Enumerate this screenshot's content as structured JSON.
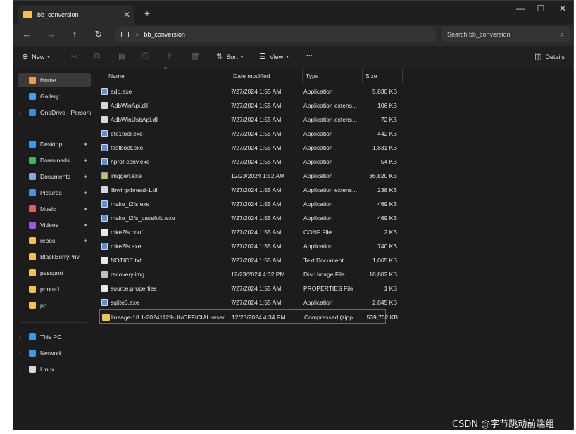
{
  "window": {
    "tab_title": "bb_conversion",
    "tab_close": "✕",
    "new_tab": "+",
    "minimize": "—",
    "maximize": "☐",
    "close": "✕"
  },
  "nav": {
    "back": "←",
    "forward": "→",
    "up": "↑",
    "refresh": "↻",
    "path": "bb_conversion",
    "search_placeholder": "Search bb_conversion"
  },
  "toolbar": {
    "new": "New",
    "sort": "Sort",
    "view": "View",
    "more": "···",
    "details": "Details"
  },
  "sidebar": {
    "items": [
      {
        "label": "Home",
        "icon": "home-icon",
        "color": "#e8a04a"
      },
      {
        "label": "Gallery",
        "icon": "gallery-icon",
        "color": "#4aa0e8"
      },
      {
        "label": "OneDrive - Persona",
        "icon": "cloud-icon",
        "color": "#3a8fd8"
      },
      {
        "label": "Desktop",
        "icon": "desktop-icon",
        "color": "#3a9ae8"
      },
      {
        "label": "Downloads",
        "icon": "download-icon",
        "color": "#3ab86a"
      },
      {
        "label": "Documents",
        "icon": "documents-icon",
        "color": "#8aa8d8"
      },
      {
        "label": "Pictures",
        "icon": "pictures-icon",
        "color": "#4a90e0"
      },
      {
        "label": "Music",
        "icon": "music-icon",
        "color": "#e05a6a"
      },
      {
        "label": "Videos",
        "icon": "videos-icon",
        "color": "#9a5ae0"
      },
      {
        "label": "repos",
        "icon": "folder-icon",
        "color": "#f2c14e"
      },
      {
        "label": "BlackBerryPriv",
        "icon": "folder-icon",
        "color": "#f2c14e"
      },
      {
        "label": "passport",
        "icon": "folder-icon",
        "color": "#f2c14e"
      },
      {
        "label": "phone1",
        "icon": "folder-icon",
        "color": "#f2c14e"
      },
      {
        "label": "pp",
        "icon": "folder-icon",
        "color": "#f2c14e"
      },
      {
        "label": "This PC",
        "icon": "pc-icon",
        "color": "#3a9ae8"
      },
      {
        "label": "Network",
        "icon": "network-icon",
        "color": "#3a9ae8"
      },
      {
        "label": "Linux",
        "icon": "linux-icon",
        "color": "#d8d8d8"
      }
    ]
  },
  "columns": {
    "name": "Name",
    "date": "Date modified",
    "type": "Type",
    "size": "Size"
  },
  "files": [
    {
      "name": "adb.exe",
      "date": "7/27/2024 1:55 AM",
      "type": "Application",
      "size": "5,830 KB",
      "kind": "exe"
    },
    {
      "name": "AdbWinApi.dll",
      "date": "7/27/2024 1:55 AM",
      "type": "Application extens...",
      "size": "106 KB",
      "kind": "dll"
    },
    {
      "name": "AdbWinUsbApi.dll",
      "date": "7/27/2024 1:55 AM",
      "type": "Application extens...",
      "size": "72 KB",
      "kind": "dll"
    },
    {
      "name": "etc1tool.exe",
      "date": "7/27/2024 1:55 AM",
      "type": "Application",
      "size": "442 KB",
      "kind": "exe"
    },
    {
      "name": "fastboot.exe",
      "date": "7/27/2024 1:55 AM",
      "type": "Application",
      "size": "1,831 KB",
      "kind": "exe"
    },
    {
      "name": "hprof-conv.exe",
      "date": "7/27/2024 1:55 AM",
      "type": "Application",
      "size": "54 KB",
      "kind": "exe"
    },
    {
      "name": "imggen.exe",
      "date": "12/23/2024 1:52 AM",
      "type": "Application",
      "size": "36,820 KB",
      "kind": "gen"
    },
    {
      "name": "libwinpthread-1.dll",
      "date": "7/27/2024 1:55 AM",
      "type": "Application extens...",
      "size": "238 KB",
      "kind": "dll"
    },
    {
      "name": "make_f2fs.exe",
      "date": "7/27/2024 1:55 AM",
      "type": "Application",
      "size": "469 KB",
      "kind": "exe"
    },
    {
      "name": "make_f2fs_casefold.exe",
      "date": "7/27/2024 1:55 AM",
      "type": "Application",
      "size": "469 KB",
      "kind": "exe"
    },
    {
      "name": "mke2fs.conf",
      "date": "7/27/2024 1:55 AM",
      "type": "CONF File",
      "size": "2 KB",
      "kind": "txt"
    },
    {
      "name": "mke2fs.exe",
      "date": "7/27/2024 1:55 AM",
      "type": "Application",
      "size": "740 KB",
      "kind": "exe"
    },
    {
      "name": "NOTICE.txt",
      "date": "7/27/2024 1:55 AM",
      "type": "Text Document",
      "size": "1,065 KB",
      "kind": "txt"
    },
    {
      "name": "recovery.img",
      "date": "12/23/2024 4:32 PM",
      "type": "Disc Image File",
      "size": "18,802 KB",
      "kind": "img"
    },
    {
      "name": "source.properties",
      "date": "7/27/2024 1:55 AM",
      "type": "PROPERTIES File",
      "size": "1 KB",
      "kind": "txt"
    },
    {
      "name": "sqlite3.exe",
      "date": "7/27/2024 1:55 AM",
      "type": "Application",
      "size": "2,845 KB",
      "kind": "exe"
    },
    {
      "name": "lineage-18.1-20241129-UNOFFICIAL-wser...",
      "date": "12/23/2024 4:34 PM",
      "type": "Compressed (zipp...",
      "size": "539,762 KB",
      "kind": "zip"
    }
  ],
  "watermark": "CSDN @字节跳动前端组"
}
